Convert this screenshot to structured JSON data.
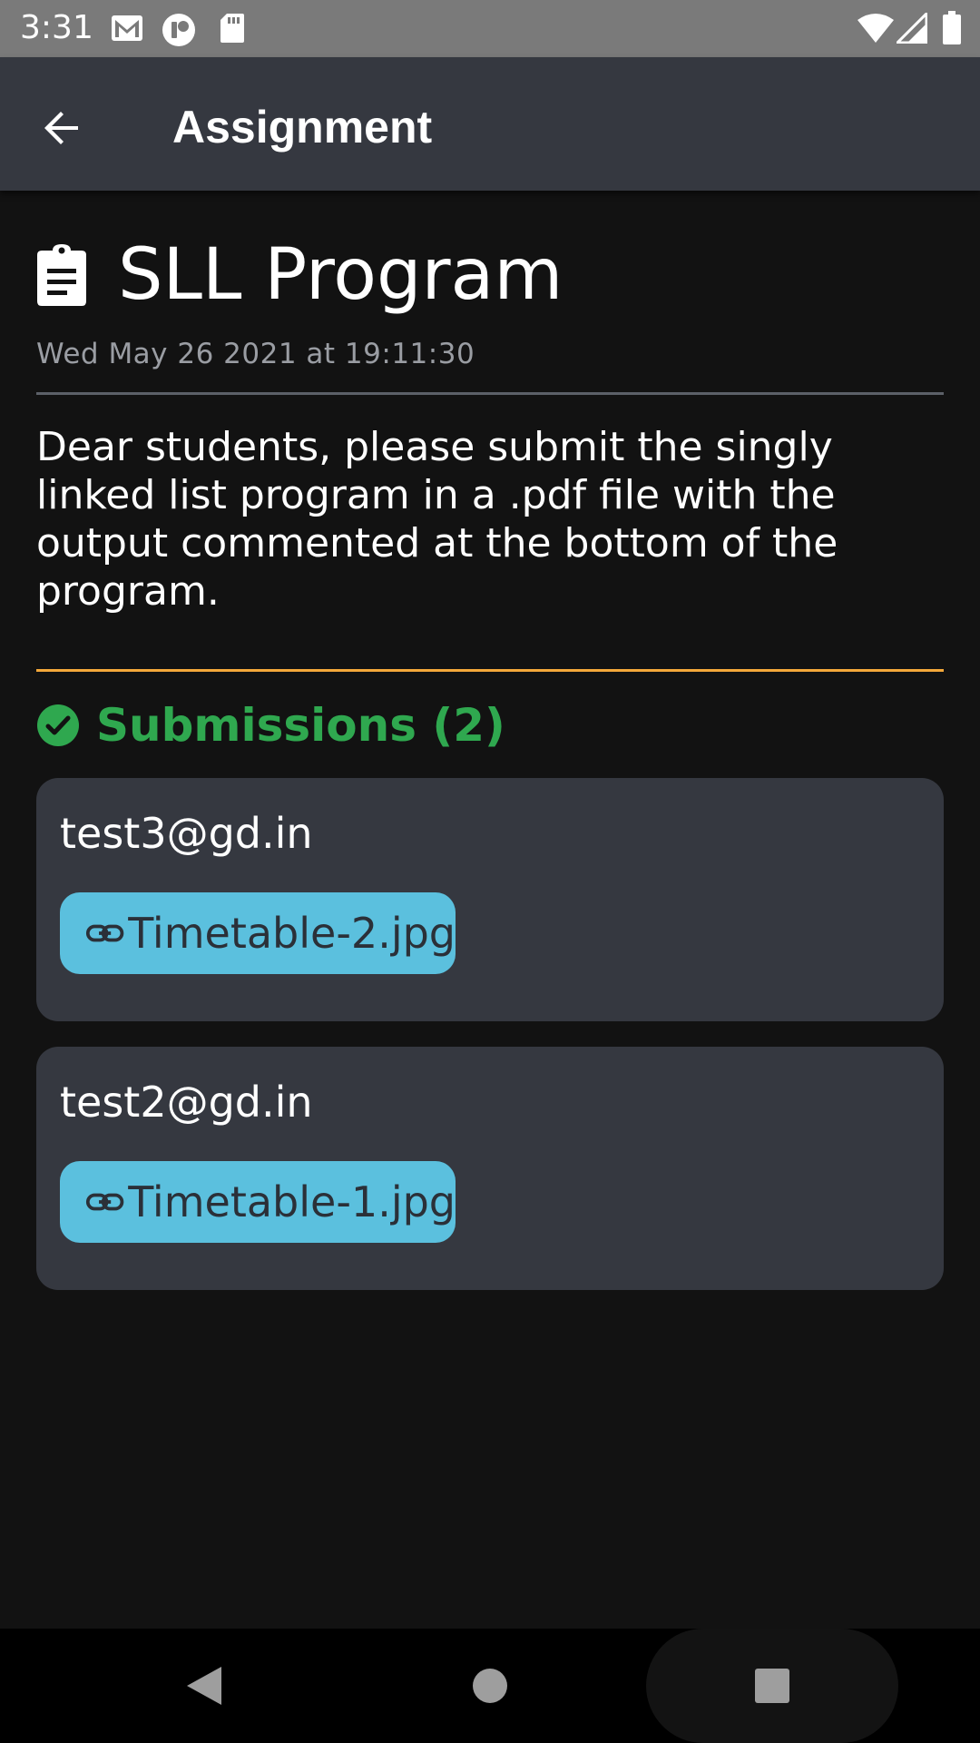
{
  "status_bar": {
    "time": "3:31",
    "left_icons": [
      "gmail-icon",
      "notification-app-icon",
      "sd-card-icon"
    ],
    "right_icons": [
      "wifi-icon",
      "cell-signal-icon",
      "battery-icon"
    ]
  },
  "app_bar": {
    "back_icon": "arrow-back-icon",
    "title": "Assignment"
  },
  "assignment": {
    "icon": "clipboard-icon",
    "title": "SLL Program",
    "date": "Wed May 26 2021 at 19:11:30",
    "description": "Dear students, please submit the singly linked list program in a .pdf file with the output commented at the bottom of the program."
  },
  "submissions": {
    "icon": "check-circle-icon",
    "title": "Submissions (2)",
    "items": [
      {
        "email": "test3@gd.in",
        "file": "Timetable-2.jpg",
        "file_icon": "link-icon"
      },
      {
        "email": "test2@gd.in",
        "file": "Timetable-1.jpg",
        "file_icon": "link-icon"
      }
    ]
  },
  "nav_bar": {
    "buttons": [
      "back-triangle-icon",
      "home-circle-icon",
      "recents-square-icon"
    ]
  },
  "colors": {
    "status_bar_bg": "#7a7a7a",
    "app_bar_bg": "#353840",
    "page_bg": "#121212",
    "card_bg": "#353840",
    "accent_orange": "#f4a83a",
    "success_green": "#2fa84f",
    "chip_blue": "#5bc0de",
    "muted_text": "#9a9da3"
  }
}
